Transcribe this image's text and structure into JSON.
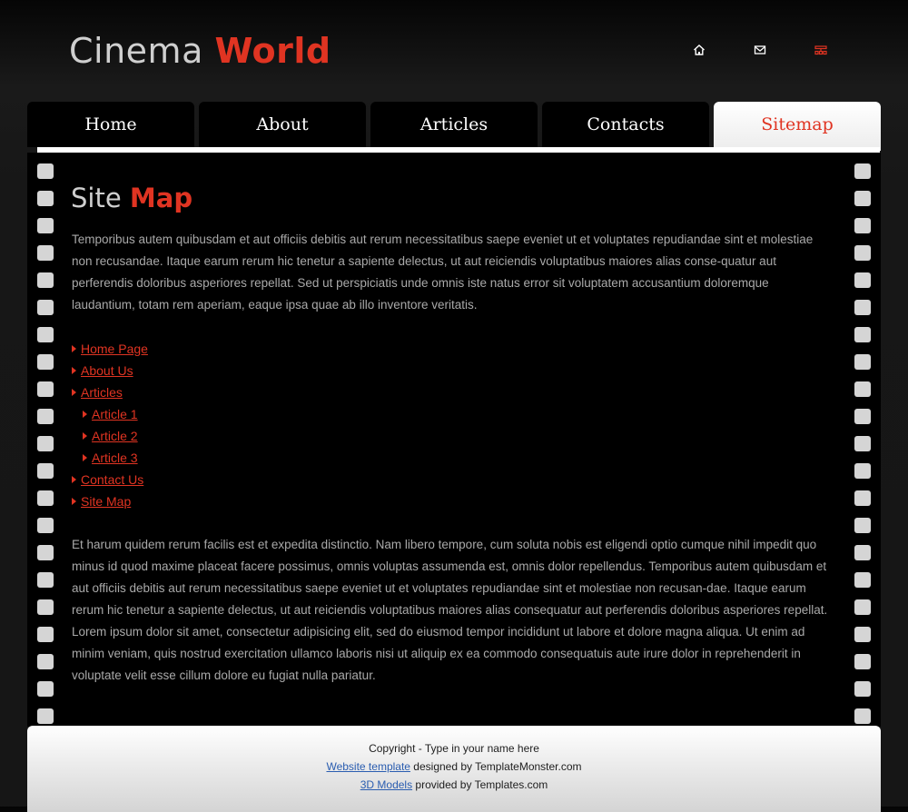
{
  "header": {
    "logo_part1": "Cinema",
    "logo_part2": "World",
    "icons": [
      "home-icon",
      "mail-icon",
      "sitemap-icon"
    ]
  },
  "nav": {
    "tabs": [
      {
        "label": "Home"
      },
      {
        "label": "About"
      },
      {
        "label": "Articles"
      },
      {
        "label": "Contacts"
      },
      {
        "label": "Sitemap"
      }
    ],
    "active": "Sitemap"
  },
  "main": {
    "title_part1": "Site",
    "title_part2": "Map",
    "paragraph1": "Temporibus autem quibusdam et aut officiis debitis aut rerum necessitatibus saepe eveniet ut et voluptates repudiandae sint et molestiae non recusandae. Itaque earum rerum hic tenetur a sapiente delectus, ut aut reiciendis voluptatibus maiores alias conse-quatur aut perferendis doloribus asperiores repellat. Sed ut perspiciatis unde omnis iste natus error sit voluptatem accusantium doloremque laudantium, totam rem aperiam, eaque ipsa quae ab illo inventore veritatis.",
    "links": [
      {
        "label": "Home Page"
      },
      {
        "label": "About Us"
      },
      {
        "label": "Articles"
      },
      {
        "label": "Article 1"
      },
      {
        "label": "Article 2"
      },
      {
        "label": "Article 3"
      },
      {
        "label": "Contact Us"
      },
      {
        "label": "Site Map"
      }
    ],
    "paragraph2": "Et harum quidem rerum facilis est et expedita distinctio. Nam libero tempore, cum soluta nobis est eligendi optio cumque nihil impedit quo minus id quod maxime placeat facere possimus, omnis voluptas assumenda est, omnis dolor repellendus. Temporibus autem quibusdam et aut officiis debitis aut rerum necessitatibus saepe eveniet ut et voluptates repudiandae sint et molestiae non recusan-dae. Itaque earum rerum hic tenetur a sapiente delectus, ut aut reiciendis voluptatibus maiores alias consequatur aut perferendis doloribus asperiores repellat. Lorem ipsum dolor sit amet, consectetur adipisicing elit, sed do eiusmod tempor incididunt ut labore et dolore magna aliqua. Ut enim ad minim veniam, quis nostrud exercitation ullamco laboris nisi ut aliquip ex ea commodo consequatuis aute irure dolor in reprehenderit in voluptate velit esse cillum dolore eu fugiat nulla pariatur."
  },
  "footer": {
    "copyright": "Copyright - Type in your name here",
    "website_template_link": "Website template",
    "designed_by": " designed by TemplateMonster.com",
    "models_link": "3D Models",
    "provided_by": " provided by Templates.com"
  },
  "colors": {
    "accent": "#e03422",
    "background": "#161616",
    "panel": "#000000",
    "body_text": "#a9a9a9",
    "film_hole": "#d5d5d5"
  }
}
